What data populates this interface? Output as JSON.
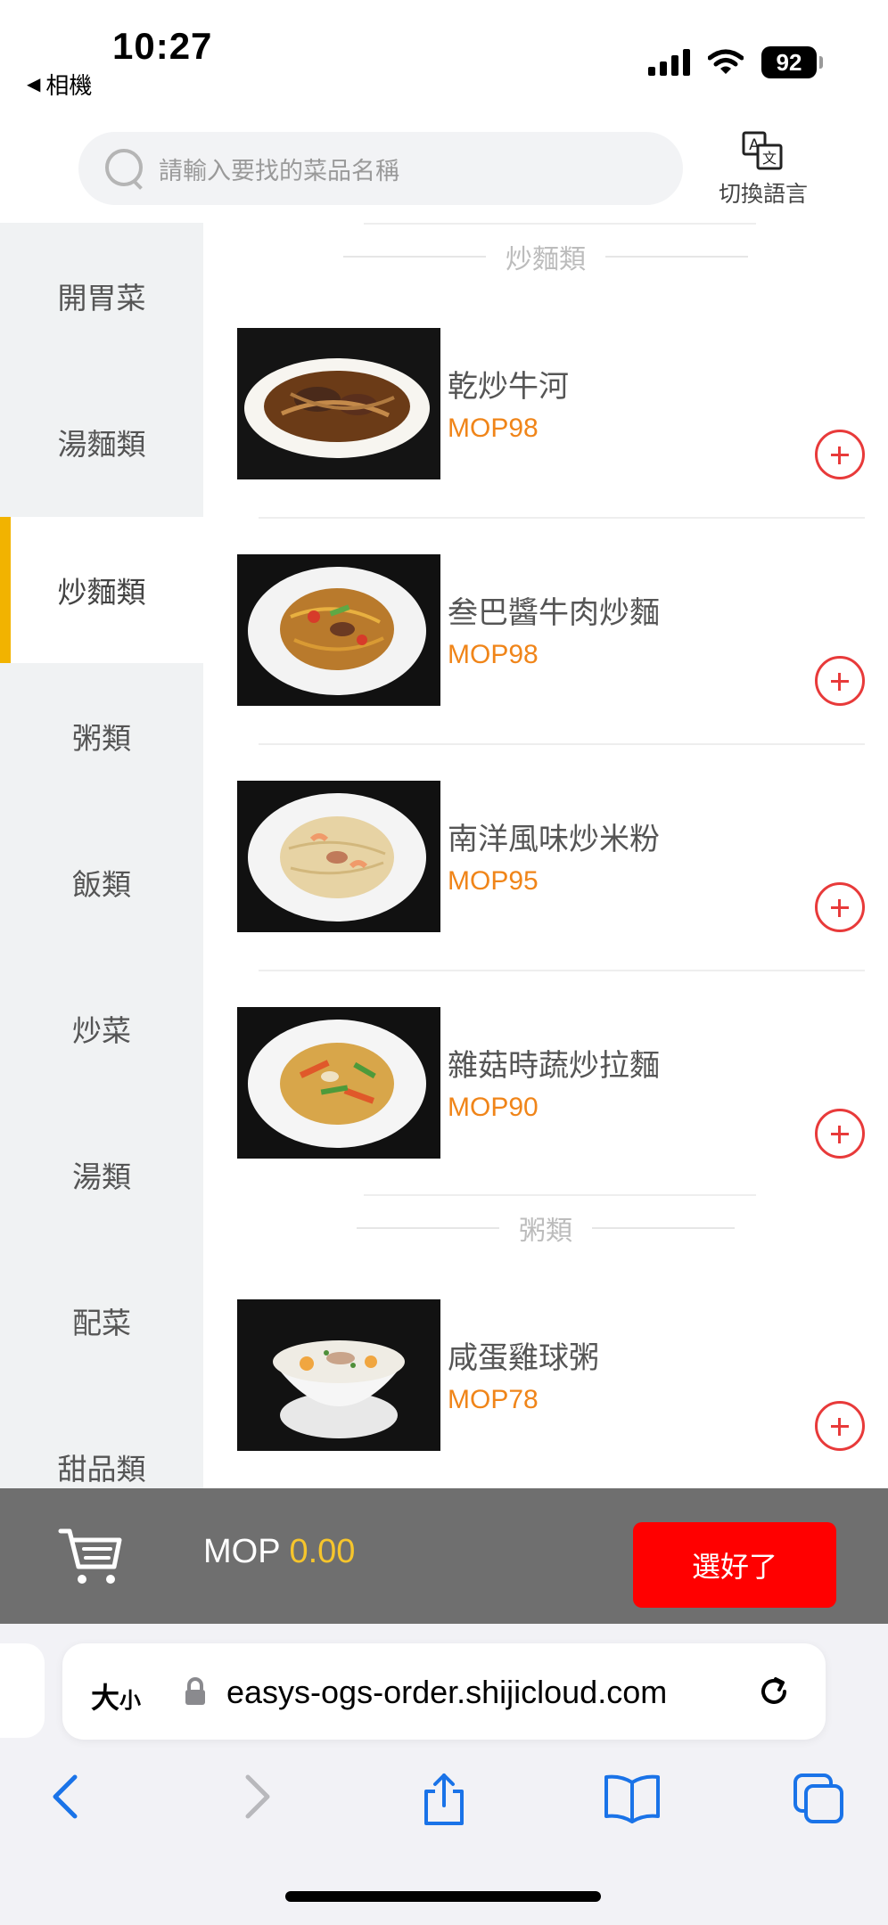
{
  "status_bar": {
    "time": "10:27",
    "back_app": "相機",
    "battery": "92"
  },
  "header": {
    "search_placeholder": "請輸入要找的菜品名稱",
    "switch_language_label": "切換語言"
  },
  "sidebar": {
    "active": "炒麵類",
    "items": [
      {
        "label": "開胃菜"
      },
      {
        "label": "湯麵類"
      },
      {
        "label": "炒麵類"
      },
      {
        "label": "粥類"
      },
      {
        "label": "飯類"
      },
      {
        "label": "炒菜"
      },
      {
        "label": "湯類"
      },
      {
        "label": "配菜"
      },
      {
        "label": "甜品類"
      }
    ]
  },
  "menu": {
    "sections": [
      {
        "title": "炒麵類",
        "dishes": [
          {
            "name": "乾炒牛河",
            "price": "MOP98"
          },
          {
            "name": "叁巴醬牛肉炒麵",
            "price": "MOP98"
          },
          {
            "name": "南洋風味炒米粉",
            "price": "MOP95"
          },
          {
            "name": "雜菇時蔬炒拉麵",
            "price": "MOP90"
          }
        ]
      },
      {
        "title": "粥類",
        "dishes": [
          {
            "name": "咸蛋雞球粥",
            "price": "MOP78"
          }
        ]
      }
    ]
  },
  "cart": {
    "currency": "MOP",
    "total": "0.00",
    "checkout_label": "選好了"
  },
  "browser": {
    "text_size_label": "大",
    "text_size_small": "小",
    "url": "easys-ogs-order.shijicloud.com"
  },
  "colors": {
    "accent_price": "#f08519",
    "add_button": "#e83a3a",
    "checkout": "#ff0000",
    "active_marker": "#f2b300",
    "cart_amount": "#f6c52c"
  }
}
